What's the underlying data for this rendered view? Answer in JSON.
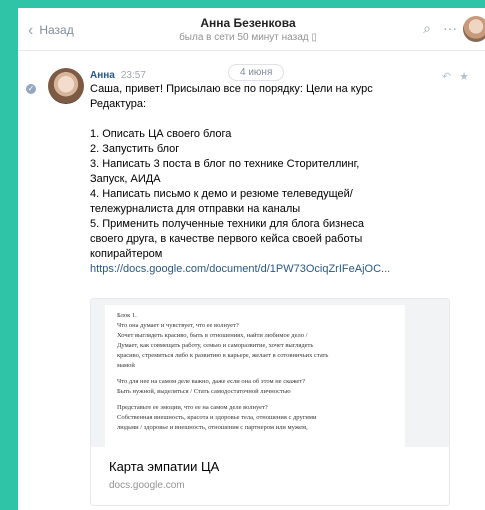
{
  "header": {
    "back_label": "Назад",
    "title": "Анна Безенкова",
    "status": "была в сети 50 минут назад",
    "status_icon": "phone-icon"
  },
  "conversation": {
    "date_label": "4 июня"
  },
  "message": {
    "author": "Анна",
    "time": "23:57",
    "lines": [
      "Саша, привет! Присылаю все по порядку: Цели на курс",
      "Редактура:",
      "",
      "1. Описать ЦА своего блога",
      "2. Запустить блог",
      "3. Написать 3 поста в блог по технике Сторителлинг,",
      "Запуск, АИДА",
      "4. Написать письмо к демо и резюме телеведущей/",
      "тележурналиста для отправки на каналы",
      "5. Применить полученные техники для блога бизнеса",
      "своего друга, в качестве первого кейса своей работы",
      "копирайтером"
    ],
    "link": "https://docs.google.com/document/d/1PW73OciqZrIFeAjOC..."
  },
  "attachment": {
    "title": "Карта эмпатии ЦА",
    "domain": "docs.google.com",
    "preview_lines": [
      "Блок 1.",
      "Что она думает и чувствует, что ее волнует?",
      "Хочет выглядеть красиво, быть в отношениях, найти любимое дело /",
      "Думает, как совмещать работу, семью и саморазвитие, хочет выглядеть",
      "красиво, стремиться либо к развитию в карьере, желает в сотовничьих стать",
      "мамой",
      "",
      "Что для нее на самом деле важно, даже если она об этом не скажет?",
      "Быть нужной, выделяться / Стать самодостаточной личностью",
      "",
      "Представьте ее эмоции, что ее на самом деле волнует?",
      "Собственная внешность, красота и здоровье тела, отношения с другими",
      "людьми / здоровье и внешность, отношения с партнером или мужем,"
    ]
  },
  "icons": {
    "back": "chevron-left-icon",
    "search": "search-icon",
    "more": "more-icon",
    "reply": "reply-icon",
    "star": "star-icon",
    "read": "check-icon"
  },
  "colors": {
    "background": "#2fc4a8",
    "link": "#2a5885",
    "muted": "#828a99"
  }
}
